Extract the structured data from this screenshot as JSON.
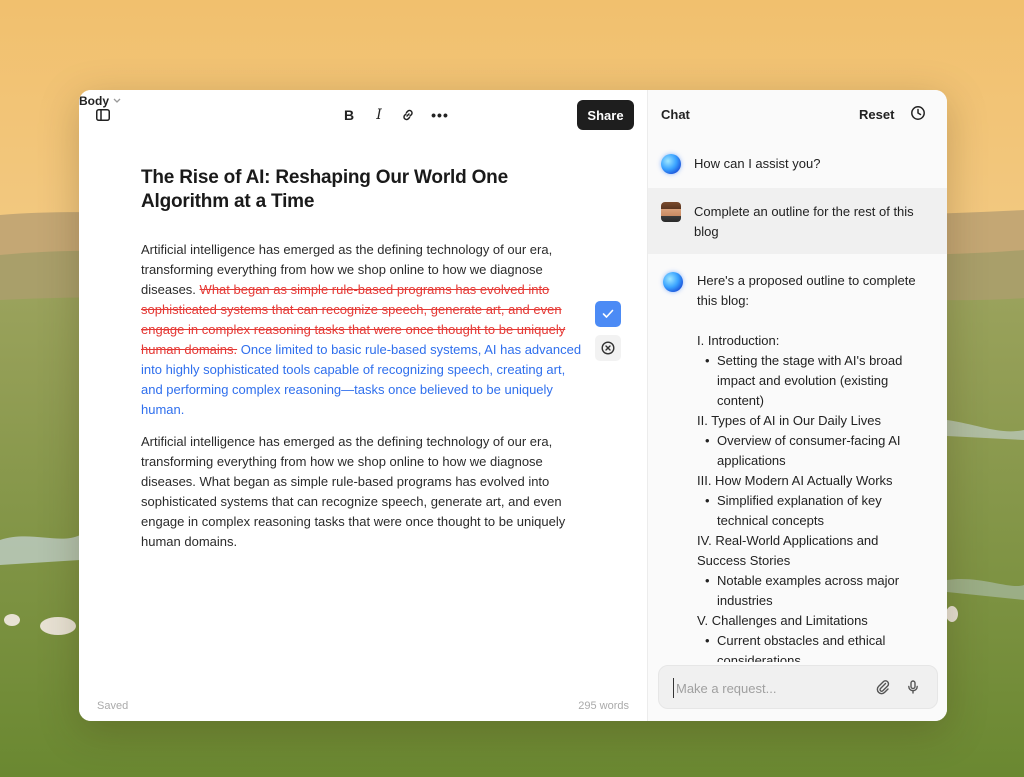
{
  "toolbar": {
    "style_label": "Body",
    "bold_label": "B",
    "italic_label": "I",
    "more_label": "•••",
    "share_label": "Share"
  },
  "document": {
    "title": "The Rise of AI: Reshaping Our World One Algorithm at a Time",
    "para1_intro": "Artificial intelligence has emerged as the defining technology of our era, transforming everything from how we shop online to how we diagnose diseases. ",
    "para1_deleted": "What began as simple rule-based programs has evolved into sophisticated systems that can recognize speech, generate art, and even engage in complex reasoning tasks that were once thought to be uniquely human domains.",
    "para1_inserted": "Once limited to basic rule-based systems, AI has advanced into highly sophisticated tools capable of recognizing speech, creating art, and performing complex reasoning—tasks once believed to be uniquely human.",
    "para2": "Artificial intelligence has emerged as the defining technology of our era, transforming everything from how we shop online to how we diagnose diseases. What began as simple rule-based programs has evolved into sophisticated systems that can recognize speech, generate art, and even engage in complex reasoning tasks that were once thought to be uniquely human domains."
  },
  "footer": {
    "status": "Saved",
    "word_count": "295 words"
  },
  "chat": {
    "title": "Chat",
    "reset_label": "Reset",
    "greeting": "How can I assist you?",
    "user_message": "Complete an outline for the rest of this blog",
    "ai_intro": "Here's a proposed outline to complete this blog:",
    "outline": [
      {
        "text": "I. Introduction:",
        "level": "main"
      },
      {
        "text": "Setting the stage with AI's broad impact and evolution (existing content)",
        "level": "sub"
      },
      {
        "text": "II. Types of AI in Our Daily Lives",
        "level": "main"
      },
      {
        "text": "Overview of consumer-facing AI applications",
        "level": "sub"
      },
      {
        "text": "III. How Modern AI Actually Works",
        "level": "main"
      },
      {
        "text": "Simplified explanation of key technical concepts",
        "level": "sub"
      },
      {
        "text": "IV. Real-World Applications and Success Stories",
        "level": "main"
      },
      {
        "text": "Notable examples across major industries",
        "level": "sub"
      },
      {
        "text": "V. Challenges and Limitations",
        "level": "main"
      },
      {
        "text": "Current obstacles and ethical considerations",
        "level": "sub"
      }
    ],
    "input_placeholder": "Make a request..."
  },
  "colors": {
    "deleted": "#e53935",
    "inserted": "#2f6fed",
    "accept": "#4c8bf5",
    "share_bg": "#1e1e1e"
  },
  "icons": [
    "sidebar-toggle-icon",
    "chevron-down-icon",
    "link-icon",
    "more-icon",
    "check-icon",
    "close-circle-icon",
    "history-icon",
    "paperclip-icon",
    "microphone-icon",
    "ai-orb-icon"
  ]
}
